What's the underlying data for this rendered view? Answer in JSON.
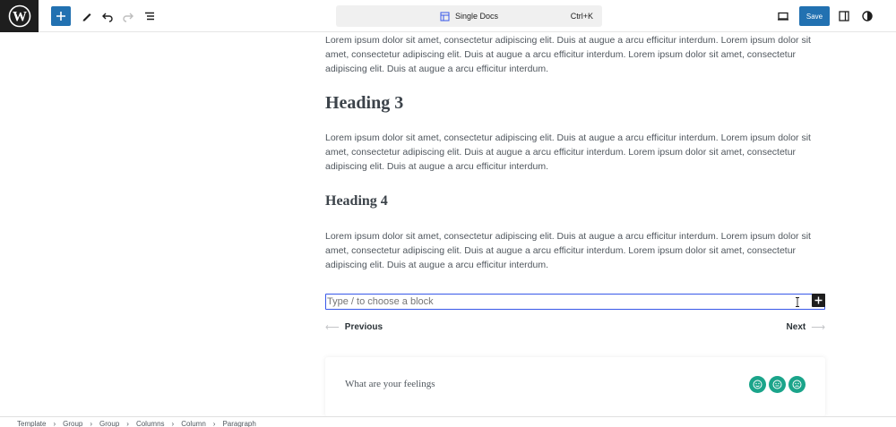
{
  "toolbar": {
    "command_title": "Single Docs",
    "command_shortcut": "Ctrl+K",
    "save_label": "Save"
  },
  "content": {
    "para_1": "Lorem ipsum dolor sit amet, consectetur adipiscing elit. Duis at augue a arcu efficitur interdum. Lorem ipsum dolor sit amet, consectetur adipiscing elit. Duis at augue a arcu efficitur interdum. Lorem ipsum dolor sit amet, consectetur adipiscing elit. Duis at augue a arcu efficitur interdum.",
    "heading_3": "Heading 3",
    "para_2": "Lorem ipsum dolor sit amet, consectetur adipiscing elit. Duis at augue a arcu efficitur interdum. Lorem ipsum dolor sit amet, consectetur adipiscing elit. Duis at augue a arcu efficitur interdum. Lorem ipsum dolor sit amet, consectetur adipiscing elit. Duis at augue a arcu efficitur interdum.",
    "heading_4": "Heading 4",
    "para_3": "Lorem ipsum dolor sit amet, consectetur adipiscing elit. Duis at augue a arcu efficitur interdum. Lorem ipsum dolor sit amet, consectetur adipiscing elit. Duis at augue a arcu efficitur interdum. Lorem ipsum dolor sit amet, consectetur adipiscing elit. Duis at augue a arcu efficitur interdum.",
    "block_placeholder": "Type / to choose a block"
  },
  "post_nav": {
    "previous_label": "Previous",
    "next_label": "Next"
  },
  "feedback": {
    "title": "What are your feelings"
  },
  "breadcrumb": [
    "Template",
    "Group",
    "Group",
    "Columns",
    "Column",
    "Paragraph"
  ],
  "colors": {
    "accent": "#2271b1",
    "focus": "#3858e9",
    "emoji": "#1aa48a",
    "dark": "#1e1e1e"
  },
  "icons": [
    "wordpress-logo",
    "plus-icon",
    "pencil-icon",
    "undo-icon",
    "redo-icon",
    "list-view-icon",
    "document-icon",
    "desktop-icon",
    "sidebar-icon",
    "contrast-icon",
    "arrow-left-icon",
    "arrow-right-icon",
    "smile-icon",
    "chevron-right-icon",
    "text-cursor-icon"
  ]
}
